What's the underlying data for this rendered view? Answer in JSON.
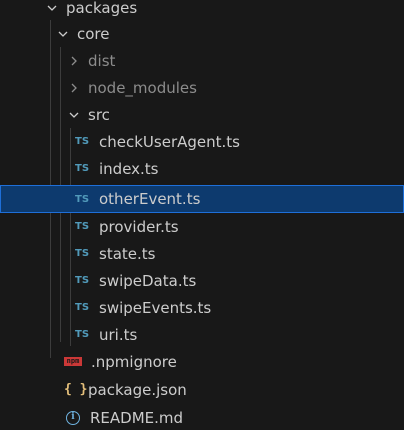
{
  "explorer": {
    "packages": {
      "label": "packages",
      "expanded": true
    },
    "core": {
      "label": "core",
      "expanded": true
    },
    "dist": {
      "label": "dist",
      "expanded": false
    },
    "node_modules": {
      "label": "node_modules",
      "expanded": false
    },
    "src": {
      "label": "src",
      "expanded": true,
      "ts_badge": "TS",
      "files": [
        {
          "name": "checkUserAgent.ts"
        },
        {
          "name": "index.ts"
        },
        {
          "name": "otherEvent.ts",
          "selected": true
        },
        {
          "name": "provider.ts"
        },
        {
          "name": "state.ts"
        },
        {
          "name": "swipeData.ts"
        },
        {
          "name": "swipeEvents.ts"
        },
        {
          "name": "uri.ts"
        }
      ]
    },
    "npmignore": {
      "label": ".npmignore",
      "icon": "npm-icon",
      "badge": "npm"
    },
    "package_json": {
      "label": "package.json",
      "icon": "json-braces-icon",
      "glyph": "{ }"
    },
    "readme": {
      "label": "README.md",
      "icon": "info-icon",
      "glyph": "i"
    }
  },
  "colors": {
    "background": "#181818",
    "text": "#cccccc",
    "dim_text": "#8c8c8c",
    "selection_bg": "#0d3a6e",
    "selection_border": "#1e6fd9",
    "ts_icon": "#519aba",
    "npm_icon": "#cb3837",
    "json_icon": "#e5c07b",
    "info_icon": "#6fb3e0"
  }
}
